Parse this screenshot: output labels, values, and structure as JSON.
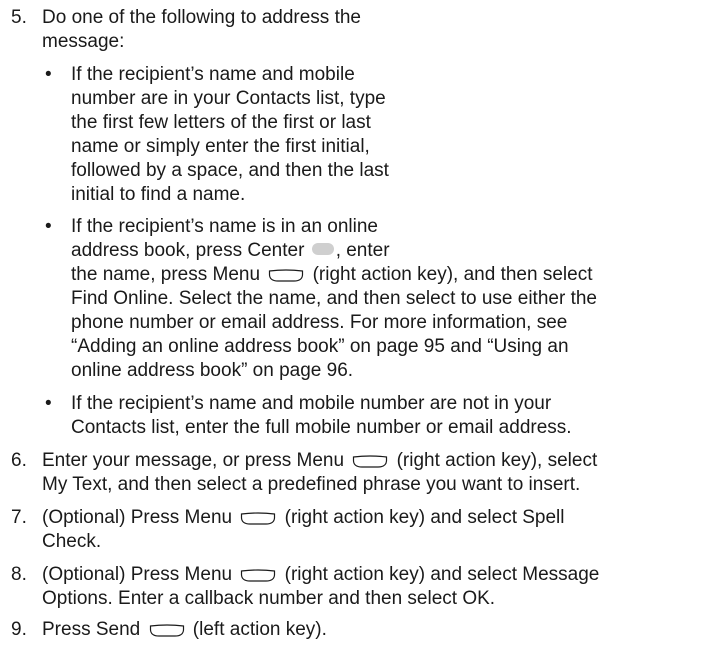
{
  "steps": [
    {
      "number": "5.",
      "lines": [
        "Do one of the following to address the",
        "message:"
      ],
      "bullets": [
        {
          "lines": [
            "If the recipient’s name and mobile",
            "number are in your Contacts list, type",
            "the first few letters of the first or last",
            "name or simply enter the first initial,",
            "followed by a space, and then the last",
            "initial to find a name."
          ]
        },
        {
          "line1a": "If the recipient’s name is in an online",
          "line2a": "address book, press Center",
          "line2b": ", enter",
          "line3a": "the name, press Menu",
          "line3b": "(right action key), and then select",
          "line4": "Find Online. Select the name, and then select to use either the",
          "line5": "phone number or email address. For more information, see",
          "line6": "“Adding an online address book” on page 95 and “Using an",
          "line7": "online address book” on page 96."
        },
        {
          "lines": [
            "If the recipient’s name and mobile number are not in your",
            "Contacts list, enter the full mobile number or email address."
          ]
        }
      ]
    },
    {
      "number": "6.",
      "line1a": "Enter your message, or press Menu",
      "line1b": "(right action key), select",
      "line2": "My Text, and then select a predefined phrase you want to insert."
    },
    {
      "number": "7.",
      "line1a": "(Optional) Press Menu",
      "line1b": "(right action key) and select Spell",
      "line2": "Check."
    },
    {
      "number": "8.",
      "line1a": "(Optional) Press Menu",
      "line1b": "(right action key) and select Message",
      "line2": "Options. Enter a callback number and then select OK."
    },
    {
      "number": "9.",
      "line1a": "Press Send",
      "line1b": "(left action key)."
    }
  ],
  "bullet_glyph": "•",
  "icons": {
    "center": "center-key-icon",
    "menu": "right-action-key-icon",
    "send": "left-action-key-icon"
  }
}
